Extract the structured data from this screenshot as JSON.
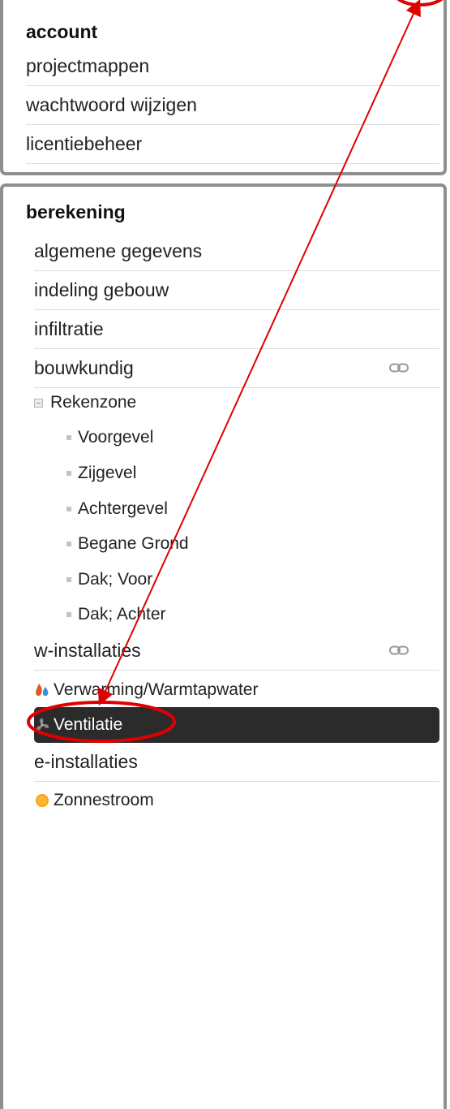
{
  "account": {
    "title": "account",
    "items": [
      {
        "label": "projectmappen"
      },
      {
        "label": "wachtwoord wijzigen"
      },
      {
        "label": "licentiebeheer"
      }
    ]
  },
  "berekening": {
    "title": "berekening",
    "items": [
      {
        "label": "algemene gegevens"
      },
      {
        "label": "indeling gebouw"
      },
      {
        "label": "infiltratie"
      },
      {
        "label": "bouwkundig",
        "icon": "link-icon"
      }
    ],
    "zone": {
      "label": "Rekenzone",
      "children": [
        {
          "label": "Voorgevel"
        },
        {
          "label": "Zijgevel"
        },
        {
          "label": "Achtergevel"
        },
        {
          "label": "Begane Grond"
        },
        {
          "label": "Dak; Voor"
        },
        {
          "label": "Dak; Achter"
        }
      ]
    },
    "w_installaties": {
      "label": "w-installaties",
      "icon": "link-icon"
    },
    "w_items": [
      {
        "label": "Verwarming/Warmtapwater",
        "icon": "flame-drop-icon"
      },
      {
        "label": "Ventilatie",
        "icon": "fan-icon",
        "active": true
      }
    ],
    "e_installaties": {
      "label": "e-installaties"
    },
    "e_items": [
      {
        "label": "Zonnestroom",
        "icon": "sun-dot-icon"
      }
    ]
  },
  "colors": {
    "annotation": "#e00000",
    "active_bg": "#2b2b2b",
    "panel_border": "#8f8f8f"
  }
}
